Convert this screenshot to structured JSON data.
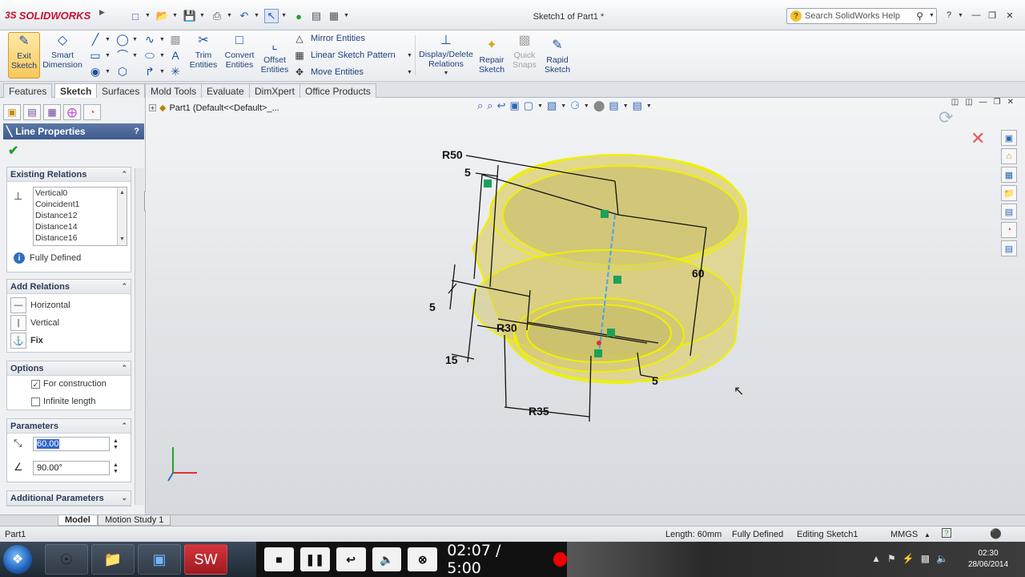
{
  "app": {
    "brand": "SOLIDWORKS",
    "brand_prefix": "3S",
    "window_title": "Sketch1 of Part1 *",
    "search_placeholder": "Search SolidWorks Help"
  },
  "command_manager": {
    "exit_sketch": "Exit\nSketch",
    "smart_dimension": "Smart\nDimension",
    "trim_entities": "Trim\nEntities",
    "convert_entities": "Convert\nEntities",
    "offset_entities": "Offset\nEntities",
    "mirror_entities": "Mirror Entities",
    "linear_sketch_pattern": "Linear Sketch Pattern",
    "move_entities": "Move Entities",
    "display_delete_relations": "Display/Delete\nRelations",
    "repair_sketch": "Repair\nSketch",
    "quick_snaps": "Quick\nSnaps",
    "rapid_sketch": "Rapid\nSketch"
  },
  "tabs": [
    "Features",
    "Sketch",
    "Surfaces",
    "Mold Tools",
    "Evaluate",
    "DimXpert",
    "Office Products"
  ],
  "active_tab": "Sketch",
  "property_manager": {
    "title": "Line Properties",
    "help": "?",
    "existing_relations": {
      "title": "Existing Relations",
      "items": [
        "Vertical0",
        "Coincident1",
        "Distance12",
        "Distance14",
        "Distance16"
      ],
      "status": "Fully Defined"
    },
    "add_relations": {
      "title": "Add Relations",
      "items": [
        "Horizontal",
        "Vertical",
        "Fix"
      ]
    },
    "options": {
      "title": "Options",
      "for_construction": "For construction",
      "for_construction_checked": true,
      "infinite_length": "Infinite length",
      "infinite_length_checked": false
    },
    "parameters": {
      "title": "Parameters",
      "length": "60.00",
      "angle": "90.00°"
    },
    "additional_parameters": "Additional Parameters"
  },
  "tree": {
    "node": "Part1  (Default<<Default>_..."
  },
  "dimensions": {
    "r50": "R50",
    "five_top": "5",
    "sixty": "60",
    "five_left": "5",
    "r30": "R30",
    "fifteen": "15",
    "five_right": "5",
    "r35": "R35"
  },
  "model_tabs": [
    "Model",
    "Motion Study 1"
  ],
  "status": {
    "part": "Part1",
    "length": "Length: 60mm",
    "defined": "Fully Defined",
    "editing": "Editing Sketch1",
    "units": "MMGS"
  },
  "player": {
    "time": "02:07 / 5:00"
  },
  "clock": {
    "time": "02:30",
    "date": "28/06/2014"
  },
  "colors": {
    "accent": "#3e5b8d",
    "model_fill": "#e6da7a",
    "model_edge": "#f3f000",
    "brand": "#c8102e"
  }
}
